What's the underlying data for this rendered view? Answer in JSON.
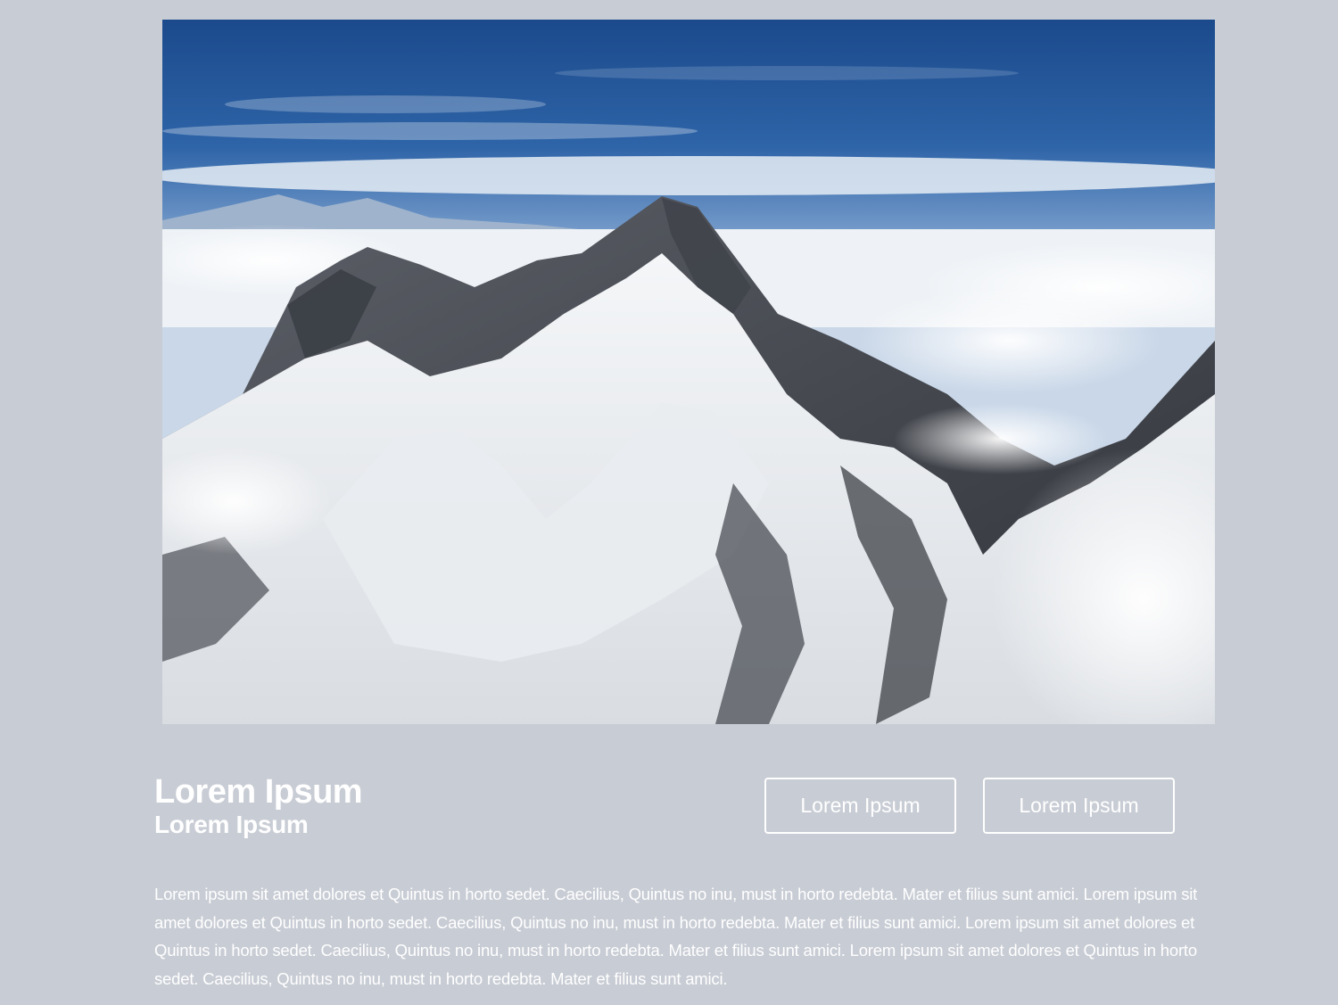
{
  "hero": {
    "image_alt": "Snow-covered mountain peak above the clouds",
    "image_icon": "mountain-photo"
  },
  "heading": {
    "title": "Lorem Ipsum",
    "subtitle": "Lorem Ipsum"
  },
  "actions": {
    "primary_label": "Lorem Ipsum",
    "secondary_label": "Lorem Ipsum"
  },
  "body": {
    "paragraph": "Lorem ipsum sit amet dolores et Quintus in horto sedet. Caecilius, Quintus no inu, must in horto redebta. Mater et filius sunt amici. Lorem ipsum sit amet dolores et Quintus in horto sedet. Caecilius, Quintus no inu, must in horto redebta. Mater et filius sunt amici. Lorem ipsum sit amet dolores et Quintus in horto sedet. Caecilius, Quintus no inu, must in horto redebta. Mater et filius sunt amici. Lorem ipsum sit amet dolores et Quintus in horto sedet. Caecilius, Quintus no inu, must in horto redebta. Mater et filius sunt amici."
  },
  "colors": {
    "background": "#c8ccd4",
    "text": "#ffffff",
    "sky_top": "#1f4f91",
    "sky_bottom": "#8fb0d6"
  }
}
